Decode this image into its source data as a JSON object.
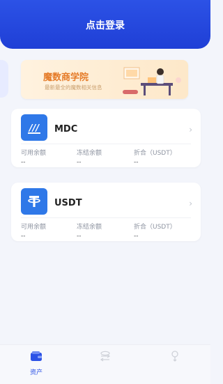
{
  "header": {
    "title": "点击登录"
  },
  "banner": {
    "title": "魔数商学院",
    "subtitle": "最新最全的魔数相关信息"
  },
  "assets": [
    {
      "icon": "mdc-logo-icon",
      "name": "MDC",
      "labels": [
        "可用余额",
        "冻结余额",
        "折合（USDT）"
      ],
      "values": [
        "--",
        "--",
        "--"
      ]
    },
    {
      "icon": "tether-logo-icon",
      "name": "USDT",
      "labels": [
        "可用余额",
        "冻结余额",
        "折合（USDT）"
      ],
      "values": [
        "--",
        "--",
        "--"
      ]
    }
  ],
  "nav": {
    "items": [
      {
        "label": "资产",
        "icon": "wallet-icon"
      },
      {
        "label": "",
        "icon": "exchange-icon"
      },
      {
        "label": "",
        "icon": "profile-icon"
      }
    ]
  },
  "colors": {
    "primary": "#2c52e6",
    "coin_blue": "#2f78e8",
    "banner_orange": "#e57b28"
  }
}
